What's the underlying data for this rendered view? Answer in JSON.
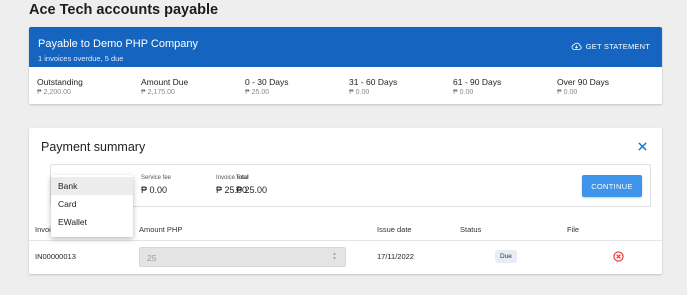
{
  "page_title": "Ace Tech accounts payable",
  "account": {
    "name": "Payable to Demo PHP Company",
    "subtitle": "1 invoices overdue, 5 due",
    "statement_label": "GET STATEMENT",
    "aging": [
      {
        "label": "Outstanding",
        "value": "₱ 2,200.00"
      },
      {
        "label": "Amount Due",
        "value": "₱ 2,175.00"
      },
      {
        "label": "0 - 30 Days",
        "value": "₱ 25.00"
      },
      {
        "label": "31 - 60 Days",
        "value": "₱ 0.00"
      },
      {
        "label": "61 - 90 Days",
        "value": "₱ 0.00"
      },
      {
        "label": "Over 90 Days",
        "value": "₱ 0.00"
      }
    ]
  },
  "payment": {
    "title": "Payment summary",
    "service_fee": {
      "label": "Service fee",
      "value": "₱ 0.00"
    },
    "invoice_total": {
      "label": "Invoice total",
      "value": "₱ 25.00"
    },
    "total": {
      "label": "Total",
      "value": "₱ 25.00"
    },
    "continue_label": "CONTINUE",
    "method_options": [
      "Bank",
      "Card",
      "EWallet"
    ],
    "selected_method": "Bank",
    "table": {
      "headers": {
        "invoice": "Invoi",
        "amount": "Amount PHP",
        "issue_date": "Issue date",
        "status": "Status",
        "file": "File"
      },
      "rows": [
        {
          "invoice": "IN00000013",
          "amount": "25",
          "issue_date": "17/11/2022",
          "status": "Due"
        }
      ]
    }
  },
  "colors": {
    "header_blue": "#1565c0",
    "button_blue": "#3d94ea",
    "remove_red": "#e53935",
    "close_blue": "#1976d2"
  }
}
